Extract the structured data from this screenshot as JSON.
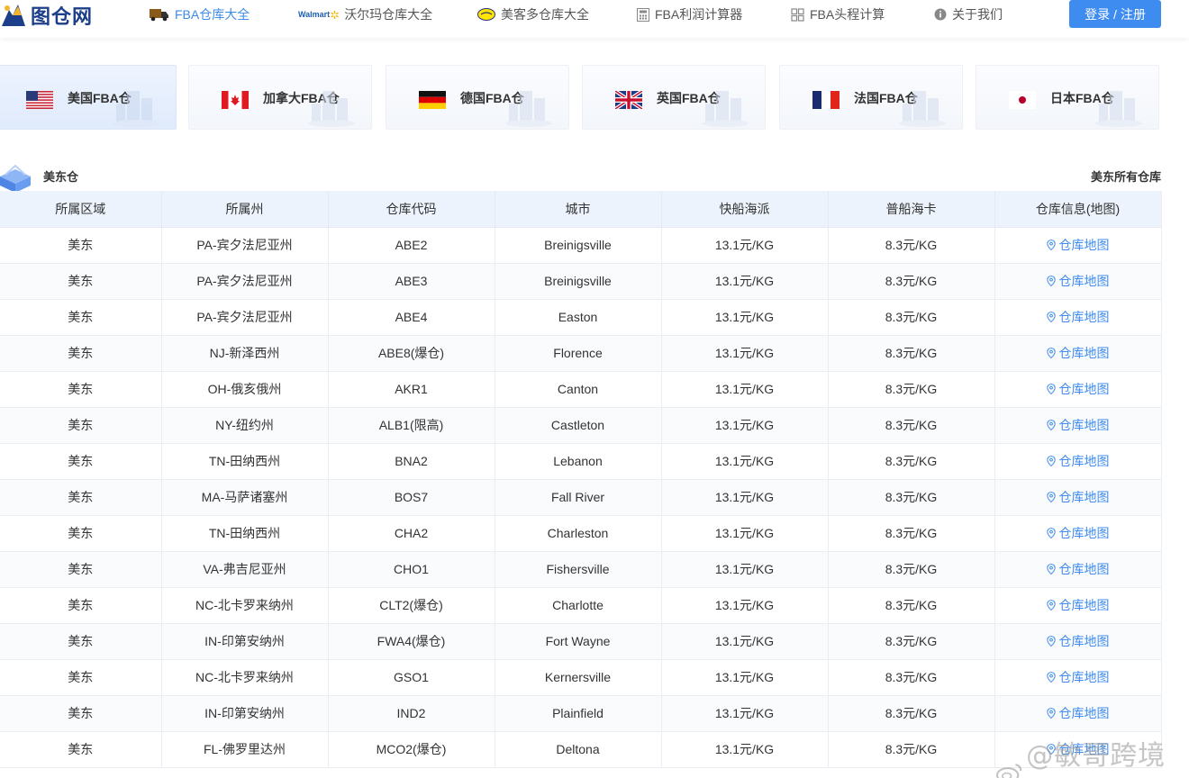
{
  "header": {
    "logo_text": "图仓网",
    "nav": [
      {
        "label": "FBA仓库大全",
        "icon": "truck-icon",
        "active": true
      },
      {
        "label": "沃尔玛仓库大全",
        "icon": "walmart-logo-icon",
        "active": false
      },
      {
        "label": "美客多仓库大全",
        "icon": "mercadolibre-logo-icon",
        "active": false
      },
      {
        "label": "FBA利润计算器",
        "icon": "calculator-icon",
        "active": false
      },
      {
        "label": "FBA头程计算",
        "icon": "grid-calculator-icon",
        "active": false
      },
      {
        "label": "关于我们",
        "icon": "info-icon",
        "active": false
      }
    ],
    "walmart_logo_text": "Walmart",
    "login_label": "登录 / 注册"
  },
  "tabs": [
    {
      "label": "美国FBA仓",
      "flag": "us-flag-icon",
      "active": true
    },
    {
      "label": "加拿大FBA仓",
      "flag": "ca-flag-icon",
      "active": false
    },
    {
      "label": "德国FBA仓",
      "flag": "de-flag-icon",
      "active": false
    },
    {
      "label": "英国FBA仓",
      "flag": "uk-flag-icon",
      "active": false
    },
    {
      "label": "法国FBA仓",
      "flag": "fr-flag-icon",
      "active": false
    },
    {
      "label": "日本FBA仓",
      "flag": "jp-flag-icon",
      "active": false
    }
  ],
  "section": {
    "title": "美东仓",
    "all_link": "美东所有仓库"
  },
  "table": {
    "headers": [
      "所属区域",
      "所属州",
      "仓库代码",
      "城市",
      "快船海派",
      "普船海卡",
      "仓库信息(地图)"
    ],
    "map_label": "仓库地图",
    "rows": [
      [
        "美东",
        "PA-宾夕法尼亚州",
        "ABE2",
        "Breinigsville",
        "13.1元/KG",
        "8.3元/KG"
      ],
      [
        "美东",
        "PA-宾夕法尼亚州",
        "ABE3",
        "Breinigsville",
        "13.1元/KG",
        "8.3元/KG"
      ],
      [
        "美东",
        "PA-宾夕法尼亚州",
        "ABE4",
        "Easton",
        "13.1元/KG",
        "8.3元/KG"
      ],
      [
        "美东",
        "NJ-新泽西州",
        "ABE8(爆仓)",
        "Florence",
        "13.1元/KG",
        "8.3元/KG"
      ],
      [
        "美东",
        "OH-俄亥俄州",
        "AKR1",
        "Canton",
        "13.1元/KG",
        "8.3元/KG"
      ],
      [
        "美东",
        "NY-纽约州",
        "ALB1(限高)",
        "Castleton",
        "13.1元/KG",
        "8.3元/KG"
      ],
      [
        "美东",
        "TN-田纳西州",
        "BNA2",
        "Lebanon",
        "13.1元/KG",
        "8.3元/KG"
      ],
      [
        "美东",
        "MA-马萨诸塞州",
        "BOS7",
        "Fall River",
        "13.1元/KG",
        "8.3元/KG"
      ],
      [
        "美东",
        "TN-田纳西州",
        "CHA2",
        "Charleston",
        "13.1元/KG",
        "8.3元/KG"
      ],
      [
        "美东",
        "VA-弗吉尼亚州",
        "CHO1",
        "Fishersville",
        "13.1元/KG",
        "8.3元/KG"
      ],
      [
        "美东",
        "NC-北卡罗来纳州",
        "CLT2(爆仓)",
        "Charlotte",
        "13.1元/KG",
        "8.3元/KG"
      ],
      [
        "美东",
        "IN-印第安纳州",
        "FWA4(爆仓)",
        "Fort Wayne",
        "13.1元/KG",
        "8.3元/KG"
      ],
      [
        "美东",
        "NC-北卡罗来纳州",
        "GSO1",
        "Kernersville",
        "13.1元/KG",
        "8.3元/KG"
      ],
      [
        "美东",
        "IN-印第安纳州",
        "IND2",
        "Plainfield",
        "13.1元/KG",
        "8.3元/KG"
      ],
      [
        "美东",
        "FL-佛罗里达州",
        "MCO2(爆仓)",
        "Deltona",
        "13.1元/KG",
        "8.3元/KG"
      ]
    ]
  },
  "watermark": "@敏哥跨境记",
  "colors": {
    "accent": "#3f8cf0",
    "header_bg": "#ecf3fd",
    "logo": "#1d3f8a"
  }
}
